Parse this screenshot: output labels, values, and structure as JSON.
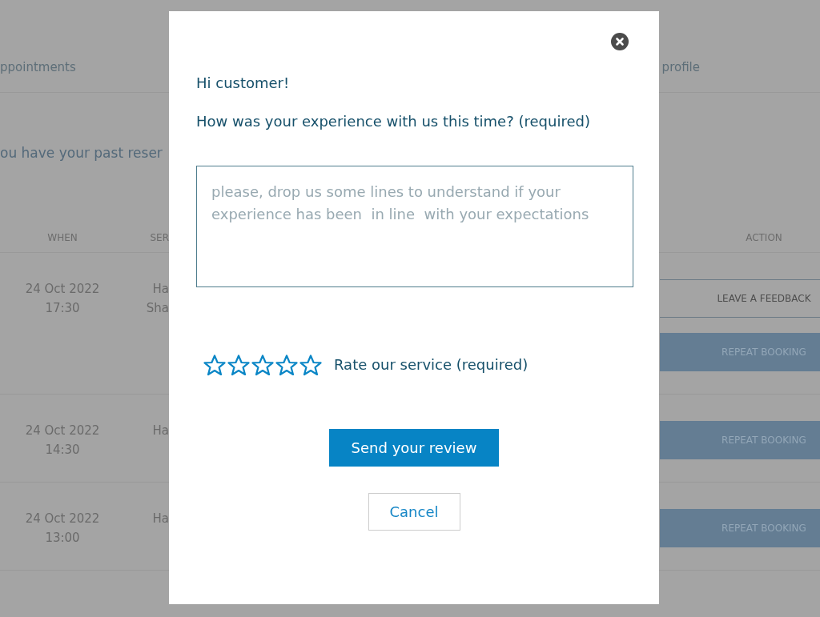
{
  "nav": [
    "ppointments",
    "profile"
  ],
  "heading": "ou have your past reser",
  "table": {
    "columns": [
      "WHEN",
      "SER",
      "ACTION"
    ],
    "rows": [
      {
        "date": "24 Oct 2022",
        "time": "17:30",
        "service": [
          "Ha",
          "Sha"
        ],
        "actions": [
          {
            "kind": "outline",
            "label": "LEAVE A FEEDBACK"
          },
          {
            "kind": "filled",
            "label": "REPEAT BOOKING"
          }
        ]
      },
      {
        "date": "24 Oct 2022",
        "time": "14:30",
        "service": [
          "Ha"
        ],
        "actions": [
          {
            "kind": "filled",
            "label": "REPEAT BOOKING"
          }
        ]
      },
      {
        "date": "24 Oct 2022",
        "time": "13:00",
        "service": [
          "Ha"
        ],
        "actions": [
          {
            "kind": "filled",
            "label": "REPEAT BOOKING"
          }
        ]
      }
    ]
  },
  "review_dialog": {
    "greeting": "Hi customer!",
    "question": "How was your experience with us this time? (required)",
    "feedback_field": {
      "placeholder": "please, drop us some lines to understand if your experience has been  in line  with your expectations"
    },
    "rating": {
      "stars": 0,
      "label": "Rate our service (required)"
    },
    "buttons": [
      {
        "kind": "primary",
        "label": "Send your review"
      },
      {
        "kind": "secondary",
        "label": "Cancel"
      }
    ]
  }
}
